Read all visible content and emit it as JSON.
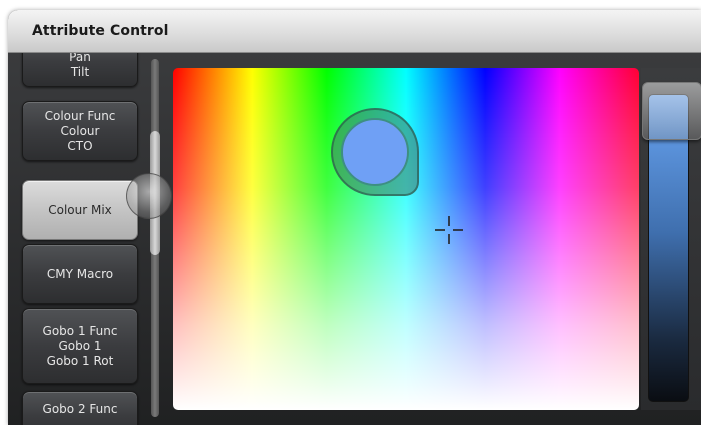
{
  "window": {
    "title": "Attribute Control"
  },
  "attribute_buttons": [
    {
      "lines": [
        "Pan",
        "Tilt"
      ],
      "selected": false
    },
    {
      "lines": [
        "Colour Func",
        "Colour",
        "CTO"
      ],
      "selected": false
    },
    {
      "lines": [
        "Colour Mix"
      ],
      "selected": true
    },
    {
      "lines": [
        "CMY Macro"
      ],
      "selected": false
    },
    {
      "lines": [
        "Gobo 1 Func",
        "Gobo 1",
        "Gobo 1 Rot"
      ],
      "selected": false
    },
    {
      "lines": [
        "Gobo 2 Func"
      ],
      "selected": false
    }
  ],
  "colour_picker": {
    "selected_colour": "#6fa0f5",
    "icons": [
      "crosshair-icon"
    ]
  },
  "intensity_slider": {
    "level": 0.97,
    "fill_top_colour": "#6aa6f4",
    "fill_bottom_colour": "#0a0d12"
  },
  "colors": {
    "accent_selected": "#c8c8c8",
    "button_dark": "#3b3c3f"
  }
}
